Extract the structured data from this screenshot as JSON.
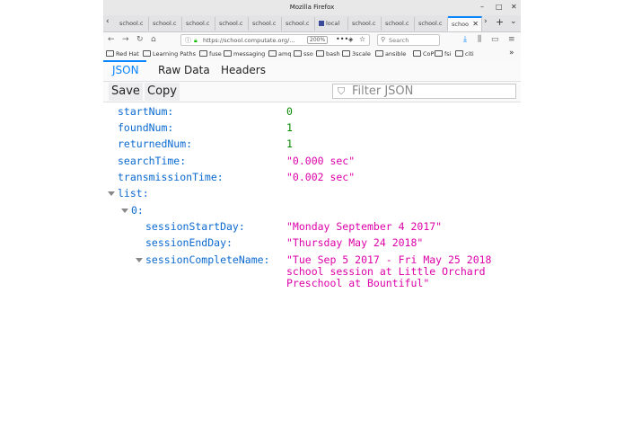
{
  "window": {
    "title": "Mozilla Firefox"
  },
  "tabs": [
    {
      "label": "school.c"
    },
    {
      "label": "school.c"
    },
    {
      "label": "school.c"
    },
    {
      "label": "school.c"
    },
    {
      "label": "school.c"
    },
    {
      "label": "school.c"
    },
    {
      "label": "local"
    },
    {
      "label": "school.c"
    },
    {
      "label": "school.c"
    },
    {
      "label": "school.c"
    },
    {
      "label": "schoo"
    }
  ],
  "navbar": {
    "url": "https://school.computate.org/...",
    "zoom": "200%",
    "search_placeholder": "Search"
  },
  "bookmarks": [
    "Red Hat",
    "Learning Paths",
    "fuse",
    "messaging",
    "amq",
    "sso",
    "bash",
    "3scale",
    "ansible",
    "CoP",
    "fsi",
    "citi"
  ],
  "viewer_tabs": {
    "json": "JSON",
    "raw": "Raw Data",
    "headers": "Headers"
  },
  "toolbar": {
    "save": "Save",
    "copy": "Copy",
    "filter_placeholder": "Filter JSON"
  },
  "json": {
    "startNum": {
      "key": "startNum:",
      "value": "0"
    },
    "foundNum": {
      "key": "foundNum:",
      "value": "1"
    },
    "returnedNum": {
      "key": "returnedNum:",
      "value": "1"
    },
    "searchTime": {
      "key": "searchTime:",
      "value": "\"0.000 sec\""
    },
    "transmissionTime": {
      "key": "transmissionTime:",
      "value": "\"0.002 sec\""
    },
    "list": {
      "key": "list:"
    },
    "item0": {
      "key": "0:"
    },
    "sessionStartDay": {
      "key": "sessionStartDay:",
      "value": "\"Monday September 4 2017\""
    },
    "sessionEndDay": {
      "key": "sessionEndDay:",
      "value": "\"Thursday May 24 2018\""
    },
    "sessionCompleteName": {
      "key": "sessionCompleteName:",
      "line1": "\"Tue Sep 5 2017 - Fri May 25 2018",
      "line2": "school session at Little Orchard",
      "line3": "Preschool at Bountiful\""
    }
  }
}
